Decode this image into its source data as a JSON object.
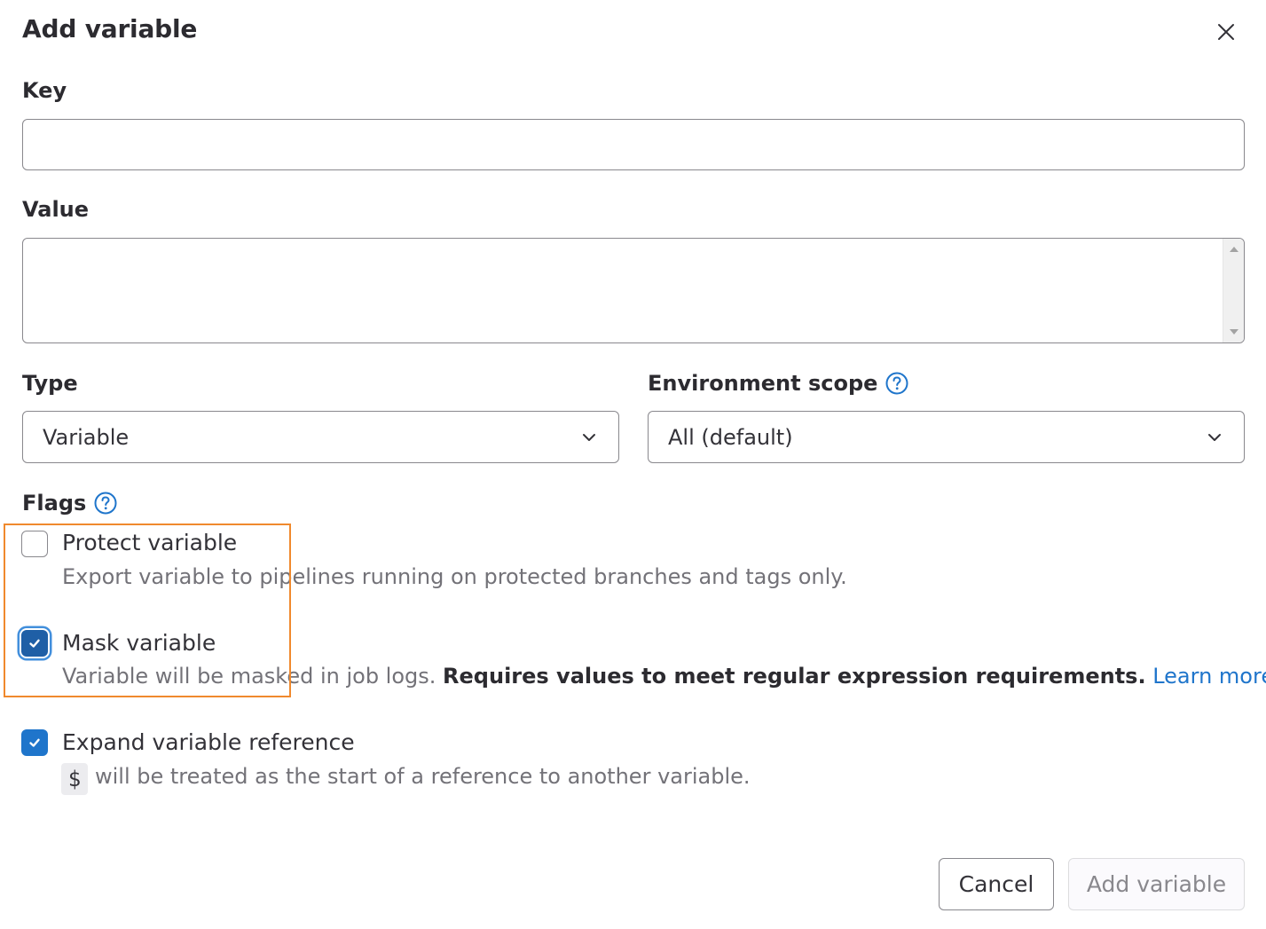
{
  "dialog": {
    "title": "Add variable"
  },
  "fields": {
    "key_label": "Key",
    "key_value": "",
    "value_label": "Value",
    "value_value": "",
    "type_label": "Type",
    "type_selected": "Variable",
    "env_label": "Environment scope",
    "env_selected": "All (default)"
  },
  "flags": {
    "label": "Flags",
    "protect": {
      "title": "Protect variable",
      "help": "Export variable to pipelines running on protected branches and tags only.",
      "checked": false
    },
    "mask": {
      "title": "Mask variable",
      "help": "Variable will be masked in job logs.",
      "help_bold": "Requires values to meet regular expression requirements.",
      "link": "Learn more.",
      "checked": true
    },
    "expand": {
      "title": "Expand variable reference",
      "code": "$",
      "help": "will be treated as the start of a reference to another variable.",
      "checked": true
    }
  },
  "footer": {
    "cancel_label": "Cancel",
    "add_label": "Add variable"
  },
  "colors": {
    "accent": "#1f75cb",
    "highlight": "#f0892d"
  },
  "icons": [
    "close-icon",
    "help-icon",
    "chevron-down-icon",
    "check-icon"
  ]
}
